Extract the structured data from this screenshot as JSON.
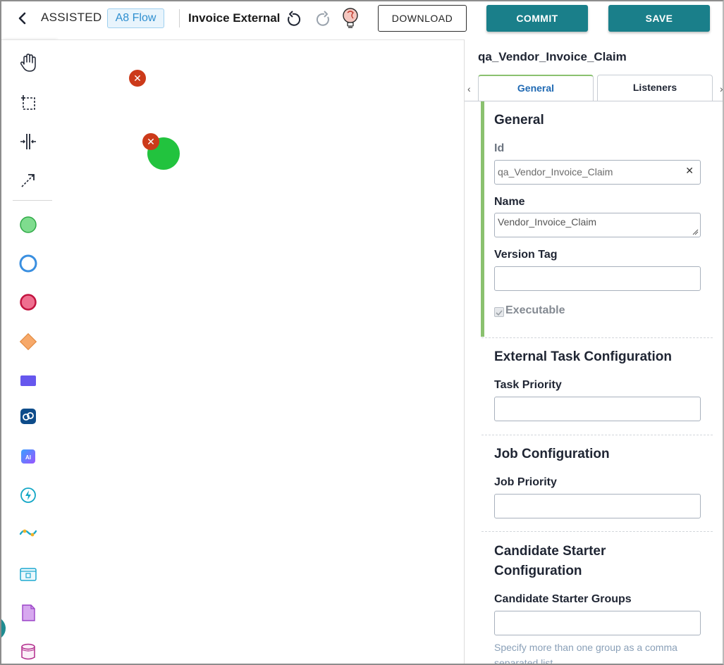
{
  "header": {
    "mode": "ASSISTED",
    "flow_badge": "A8 Flow",
    "process_name": "Invoice External",
    "download_label": "DOWNLOAD",
    "commit_label": "COMMIT",
    "save_label": "SAVE"
  },
  "toolbar": {
    "tools": [
      {
        "name": "hand-tool-icon"
      },
      {
        "name": "lasso-tool-icon"
      },
      {
        "name": "space-tool-icon"
      },
      {
        "name": "connect-tool-icon"
      },
      {
        "name": "start-event-icon"
      },
      {
        "name": "intermediate-event-icon"
      },
      {
        "name": "end-event-icon"
      },
      {
        "name": "gateway-icon"
      },
      {
        "name": "task-icon"
      },
      {
        "name": "connector-icon"
      },
      {
        "name": "ai-task-icon"
      },
      {
        "name": "lightning-event-icon"
      },
      {
        "name": "integration-icon"
      },
      {
        "name": "form-icon"
      },
      {
        "name": "document-icon"
      },
      {
        "name": "datastore-icon"
      }
    ]
  },
  "panel": {
    "element_id_title": "qa_Vendor_Invoice_Claim",
    "tabs": [
      {
        "label": "General",
        "active": true
      },
      {
        "label": "Listeners",
        "active": false
      }
    ],
    "general": {
      "heading": "General",
      "id_label": "Id",
      "id_value": "qa_Vendor_Invoice_Claim",
      "name_label": "Name",
      "name_value": "Vendor_Invoice_Claim",
      "version_label": "Version Tag",
      "version_value": "",
      "executable_label": "Executable"
    },
    "external_task": {
      "heading": "External Task Configuration",
      "priority_label": "Task Priority",
      "priority_value": ""
    },
    "job": {
      "heading": "Job Configuration",
      "priority_label": "Job Priority",
      "priority_value": ""
    },
    "candidate": {
      "heading_line1": "Candidate Starter",
      "heading_line2": "Configuration",
      "groups_label": "Candidate Starter Groups",
      "groups_value": "",
      "hint": "Specify more than one group as a comma separated list."
    }
  },
  "colors": {
    "accent_teal": "#1a7f8a",
    "section_green": "#8ac16f",
    "error_red": "#cc3a1a",
    "start_green": "#22c33e",
    "tab_blue": "#1f69b3"
  }
}
